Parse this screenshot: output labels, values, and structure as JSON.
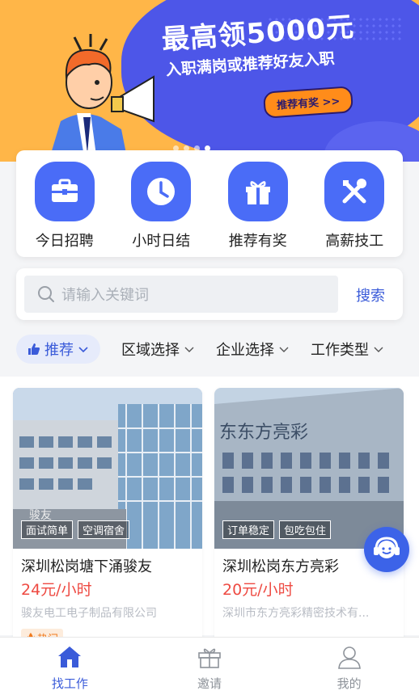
{
  "banner": {
    "headline": "最高领5000元",
    "subline": "入职满岗或推荐好友入职",
    "cta": "推荐有奖 >>",
    "colors": {
      "background": "#ffb648",
      "blob": "#4d56e8",
      "cta": "#ff8c1a"
    }
  },
  "quick_entries": [
    {
      "label": "今日招聘",
      "icon": "briefcase-icon"
    },
    {
      "label": "小时日结",
      "icon": "clock-icon"
    },
    {
      "label": "推荐有奖",
      "icon": "gift-icon"
    },
    {
      "label": "高薪技工",
      "icon": "tools-icon"
    }
  ],
  "search": {
    "placeholder": "请输入关键词",
    "button": "搜索"
  },
  "filters": {
    "recommend": "推荐",
    "items": [
      "区域选择",
      "企业选择",
      "工作类型"
    ]
  },
  "jobs": [
    {
      "tags": [
        "面试简单",
        "空调宿舍"
      ],
      "title": "深圳松岗塘下涌骏友",
      "salary": "24元/小时",
      "company": "骏友电工电子制品有限公司",
      "badge": "热门",
      "sign_text": "骏友"
    },
    {
      "tags": [
        "订单稳定",
        "包吃包住"
      ],
      "title": "深圳松岗东方亮彩",
      "salary": "20元/小时",
      "company": "深圳市东方亮彩精密技术有...",
      "sign_text": "东东方亮彩"
    }
  ],
  "tabbar": [
    {
      "label": "找工作",
      "icon": "home-icon",
      "active": true
    },
    {
      "label": "邀请",
      "icon": "gift-icon",
      "active": false
    },
    {
      "label": "我的",
      "icon": "user-icon",
      "active": false
    }
  ],
  "colors": {
    "accent": "#3a5bd9",
    "price": "#ee4a42",
    "hot": "#f07a1e"
  }
}
